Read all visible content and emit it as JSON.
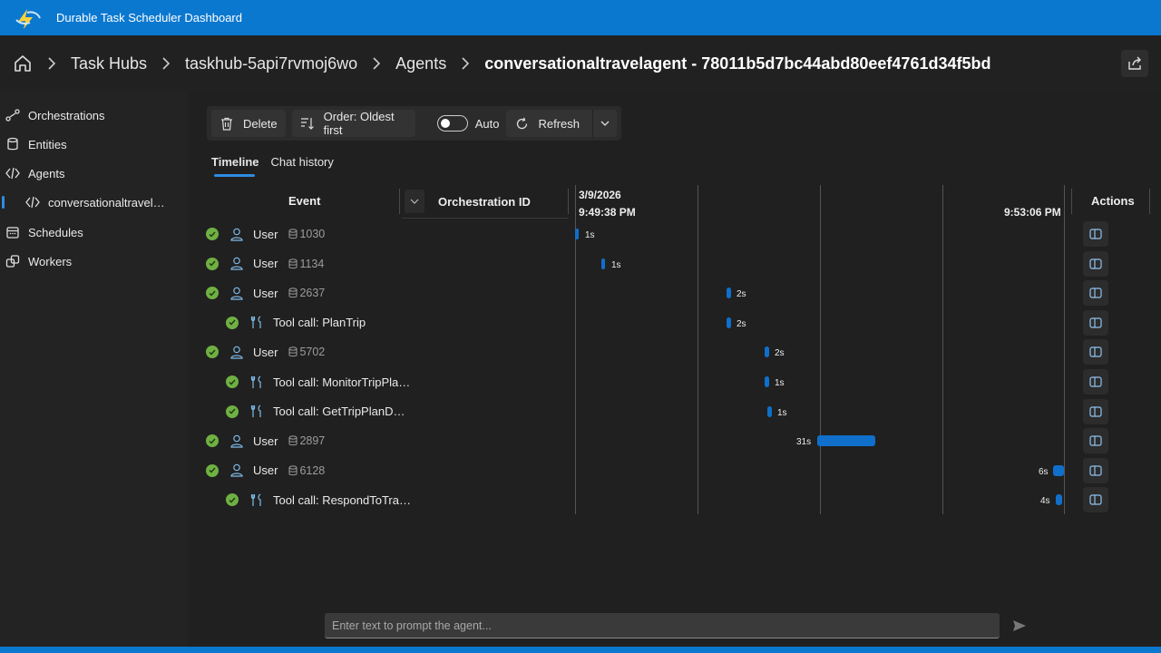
{
  "app": {
    "title": "Durable Task Scheduler Dashboard"
  },
  "breadcrumb": {
    "items": [
      "Task Hubs",
      "taskhub-5api7rvmoj6wo",
      "Agents"
    ],
    "current": "conversationaltravelagent - 78011b5d7bc44abd80eef4761d34f5bd"
  },
  "sidebar": {
    "items": [
      {
        "label": "Orchestrations",
        "icon": "orchestrations-icon"
      },
      {
        "label": "Entities",
        "icon": "database-icon"
      },
      {
        "label": "Agents",
        "icon": "agent-icon"
      },
      {
        "label": "conversationaltravel…",
        "icon": "agent-icon"
      },
      {
        "label": "Schedules",
        "icon": "calendar-icon"
      },
      {
        "label": "Workers",
        "icon": "workers-icon"
      }
    ]
  },
  "toolbar": {
    "delete_label": "Delete",
    "order_label": "Order: Oldest first",
    "auto_label": "Auto",
    "refresh_label": "Refresh"
  },
  "tabs": [
    "Timeline",
    "Chat history"
  ],
  "table": {
    "col_event": "Event",
    "col_orch": "Orchestration ID",
    "col_actions": "Actions",
    "time_start_date": "3/9/2026",
    "time_start": "9:49:38 PM",
    "time_end": "9:53:06 PM"
  },
  "rows": [
    {
      "kind": "user",
      "label": "User",
      "tokens": "1030",
      "duration": "1s"
    },
    {
      "kind": "user",
      "label": "User",
      "tokens": "1134",
      "duration": "1s"
    },
    {
      "kind": "user",
      "label": "User",
      "tokens": "2637",
      "duration": "2s"
    },
    {
      "kind": "tool",
      "label": "Tool call: PlanTrip",
      "tokens": "",
      "duration": "2s"
    },
    {
      "kind": "user",
      "label": "User",
      "tokens": "5702",
      "duration": "2s"
    },
    {
      "kind": "tool",
      "label": "Tool call: MonitorTripPla…",
      "tokens": "",
      "duration": "1s"
    },
    {
      "kind": "tool",
      "label": "Tool call: GetTripPlanD…",
      "tokens": "",
      "duration": "1s"
    },
    {
      "kind": "user",
      "label": "User",
      "tokens": "2897",
      "duration": "31s"
    },
    {
      "kind": "user",
      "label": "User",
      "tokens": "6128",
      "duration": "6s"
    },
    {
      "kind": "tool",
      "label": "Tool call: RespondToTra…",
      "tokens": "",
      "duration": "4s"
    }
  ],
  "prompt": {
    "placeholder": "Enter text to prompt the agent..."
  },
  "colors": {
    "accent": "#0b78d0",
    "bar": "#0f6fca",
    "success": "#6fb043"
  }
}
